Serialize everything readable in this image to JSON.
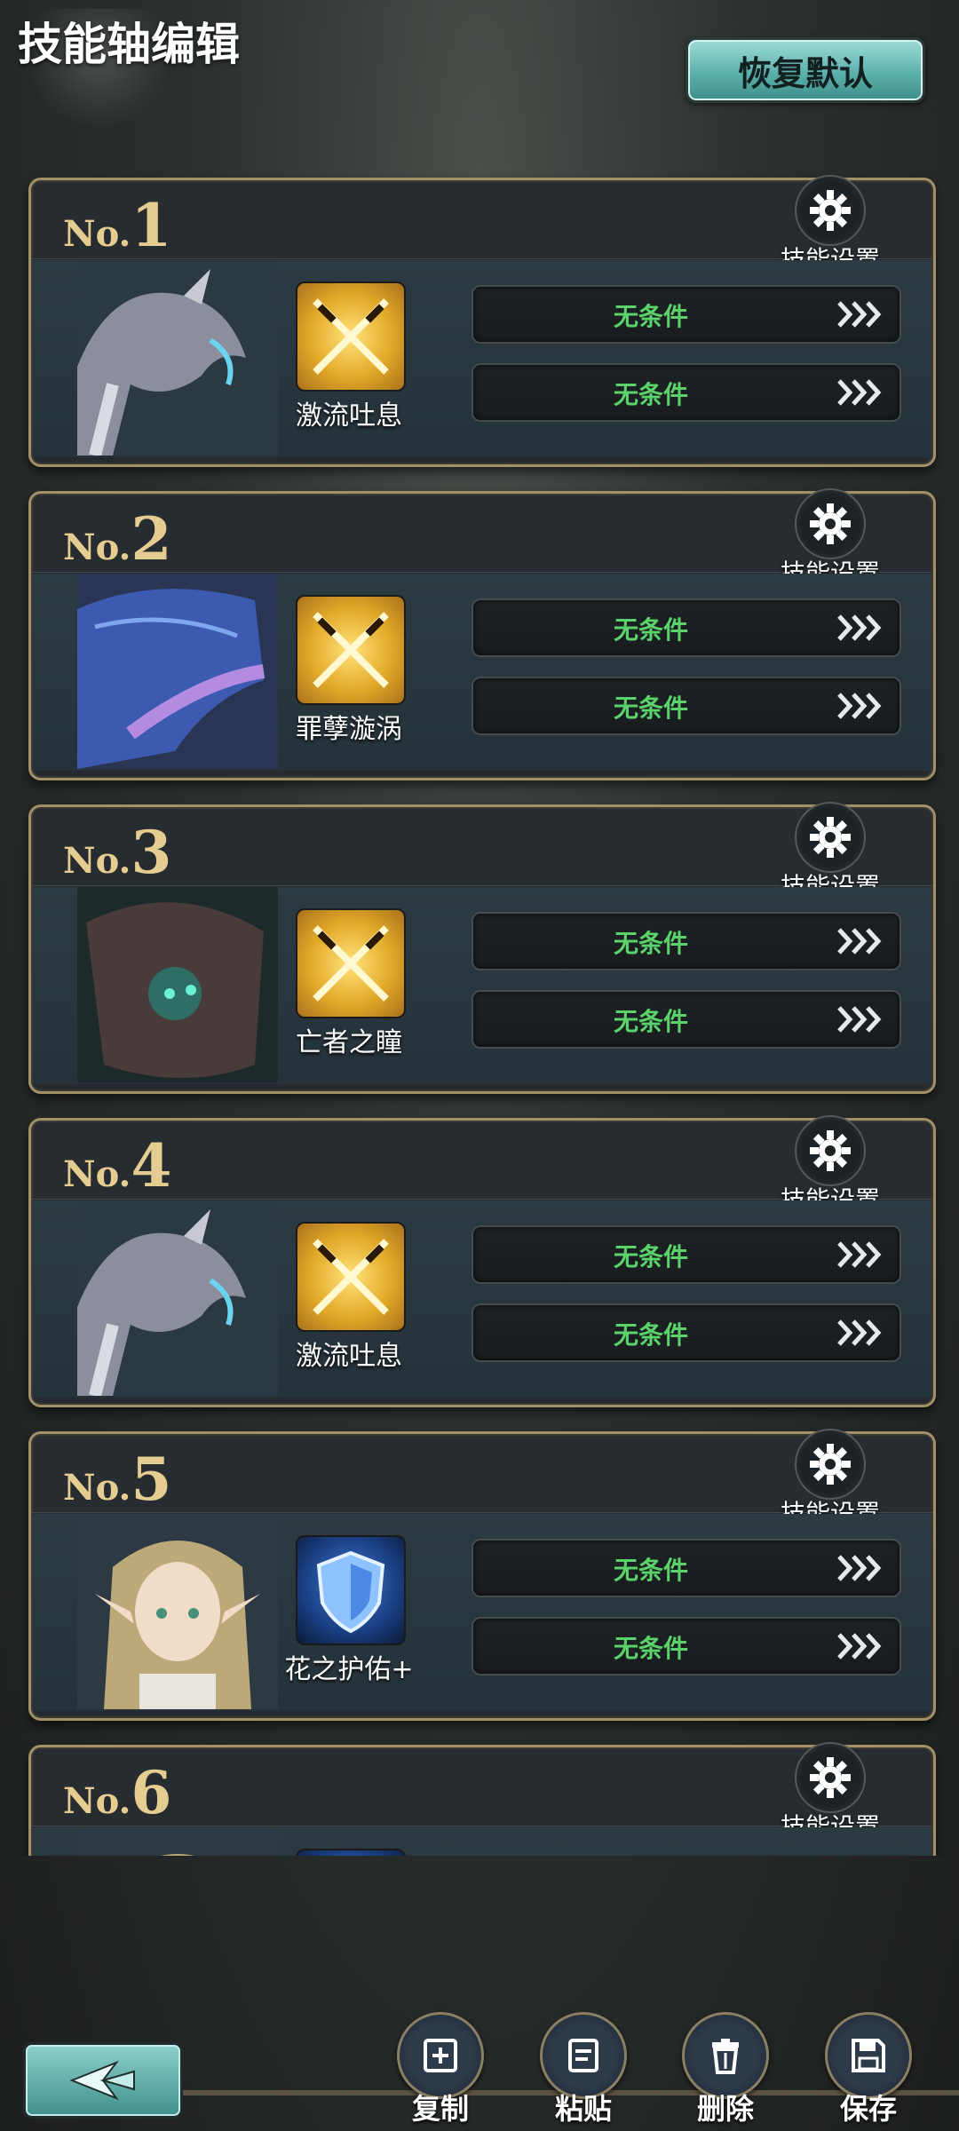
{
  "header": {
    "title": "技能轴编辑",
    "reset_label": "恢复默认"
  },
  "cards": [
    {
      "prefix": "No.",
      "number": "1",
      "skill": "激流吐息",
      "icon": "crossed-swords-icon",
      "icon_style": "gold",
      "settings_label": "技能设置",
      "conditions": [
        "无条件",
        "无条件"
      ],
      "portrait": "silver-dragon"
    },
    {
      "prefix": "No.",
      "number": "2",
      "skill": "罪孽漩涡",
      "icon": "crossed-swords-icon",
      "icon_style": "gold",
      "settings_label": "技能设置",
      "conditions": [
        "无条件",
        "无条件"
      ],
      "portrait": "purple-whale"
    },
    {
      "prefix": "No.",
      "number": "3",
      "skill": "亡者之瞳",
      "icon": "crossed-swords-icon",
      "icon_style": "gold",
      "settings_label": "技能设置",
      "conditions": [
        "无条件",
        "无条件"
      ],
      "portrait": "dark-beast"
    },
    {
      "prefix": "No.",
      "number": "4",
      "skill": "激流吐息",
      "icon": "crossed-swords-icon",
      "icon_style": "gold",
      "settings_label": "技能设置",
      "conditions": [
        "无条件",
        "无条件"
      ],
      "portrait": "silver-dragon"
    },
    {
      "prefix": "No.",
      "number": "5",
      "skill": "花之护佑+",
      "icon": "shield-icon",
      "icon_style": "blue",
      "settings_label": "技能设置",
      "conditions": [
        "无条件",
        "无条件"
      ],
      "portrait": "elf-girl"
    },
    {
      "prefix": "No.",
      "number": "6",
      "skill": "",
      "icon": "shield-icon",
      "icon_style": "blue",
      "settings_label": "技能设置",
      "conditions": [],
      "portrait": "elf-girl"
    }
  ],
  "toolbar": {
    "copy_label": "复制",
    "paste_label": "粘贴",
    "delete_label": "删除",
    "save_label": "保存"
  },
  "colors": {
    "accent_teal": "#5db1ad",
    "number_gold": "#e5cc90",
    "condition_green": "#5bd26a"
  }
}
